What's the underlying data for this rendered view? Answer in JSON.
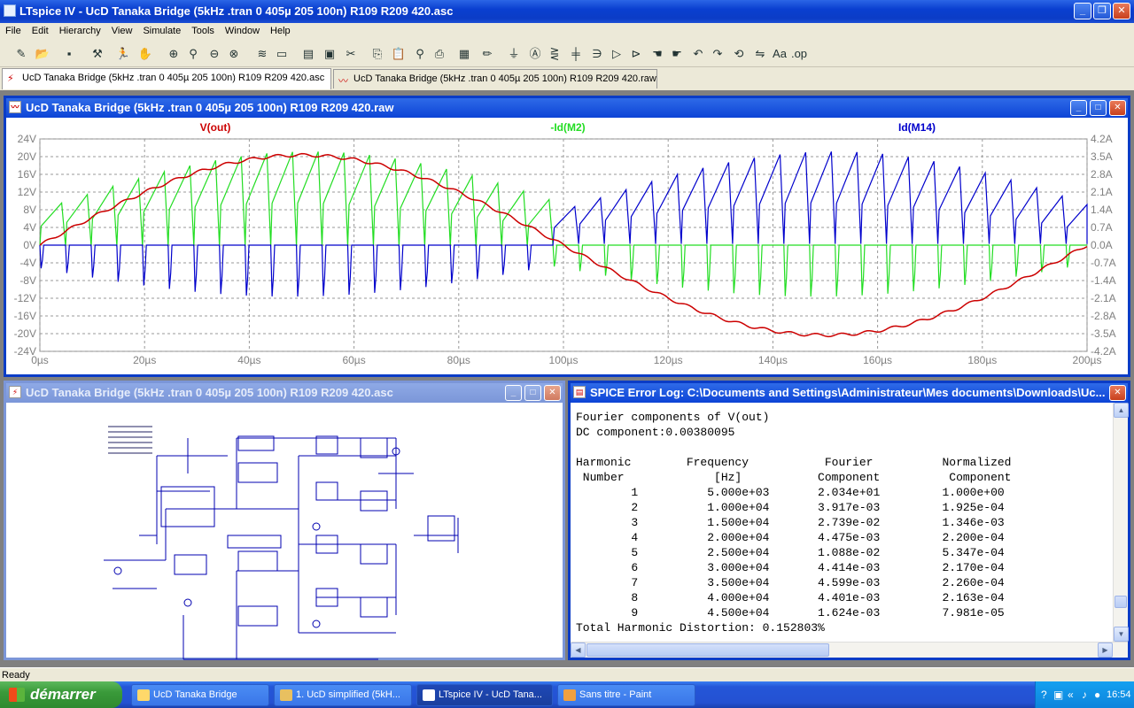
{
  "app": {
    "title": "LTspice IV - UcD Tanaka Bridge (5kHz .tran 0 405µ 205 100n) R109 R209 420.asc"
  },
  "menu": [
    "File",
    "Edit",
    "Hierarchy",
    "View",
    "Simulate",
    "Tools",
    "Window",
    "Help"
  ],
  "toolbar_icons": [
    "new-schematic-icon",
    "open-icon",
    "save-icon",
    "control-panel-icon",
    "run-icon",
    "halt-icon",
    "zoom-in-icon",
    "zoom-pan-icon",
    "zoom-out-icon",
    "zoom-fit-icon",
    "autorange-icon",
    "tile-icon",
    "cascade-icon",
    "close-window-icon",
    "cut-icon",
    "copy-icon",
    "paste-icon",
    "find-icon",
    "print-icon",
    "print-preview-icon",
    "wire-icon",
    "ground-icon",
    "label-icon",
    "resistor-icon",
    "capacitor-icon",
    "inductor-icon",
    "diode-icon",
    "component-icon",
    "move-icon",
    "drag-icon",
    "undo-icon",
    "redo-icon",
    "rotate-icon",
    "mirror-icon",
    "text-icon",
    "spice-directive-icon"
  ],
  "tabs": [
    {
      "label": "UcD Tanaka Bridge (5kHz .tran 0 405µ 205 100n) R109 R209 420.asc",
      "active": true
    },
    {
      "label": "UcD Tanaka Bridge (5kHz .tran 0 405µ 205 100n) R109 R209 420.raw",
      "active": false
    }
  ],
  "waveform_window": {
    "title": "UcD Tanaka Bridge (5kHz .tran 0 405µ 205 100n) R109 R209 420.raw",
    "traces": [
      {
        "name": "V(out)",
        "color": "#cc0000"
      },
      {
        "name": "-Id(M2)",
        "color": "#22dd22"
      },
      {
        "name": "Id(M14)",
        "color": "#0000cc"
      }
    ]
  },
  "chart_data": {
    "type": "line",
    "x_unit": "µs",
    "xlim": [
      0,
      200
    ],
    "x_ticks": [
      "0µs",
      "20µs",
      "40µs",
      "60µs",
      "80µs",
      "100µs",
      "120µs",
      "140µs",
      "160µs",
      "180µs",
      "200µs"
    ],
    "left_ylim": [
      -24,
      24
    ],
    "left_ticks": [
      "24V",
      "20V",
      "16V",
      "12V",
      "8V",
      "4V",
      "0V",
      "-4V",
      "-8V",
      "-12V",
      "-16V",
      "-20V",
      "-24V"
    ],
    "right_ylim": [
      -4.2,
      4.2
    ],
    "right_ticks": [
      "4.2A",
      "3.5A",
      "2.8A",
      "2.1A",
      "1.4A",
      "0.7A",
      "0.0A",
      "-0.7A",
      "-1.4A",
      "-2.1A",
      "-2.8A",
      "-3.5A",
      "-4.2A"
    ],
    "grid": true,
    "series": [
      {
        "name": "V(out)",
        "axis": "left",
        "kind": "sine",
        "frequency_hz": 5000,
        "amplitude": 20.34
      },
      {
        "name": "-Id(M2)",
        "axis": "right",
        "kind": "switching-sawtooth",
        "switching_period_us": 4.9
      },
      {
        "name": "Id(M14)",
        "axis": "right",
        "kind": "switching-sawtooth",
        "switching_period_us": 4.9
      }
    ]
  },
  "schematic_window": {
    "title": "UcD Tanaka Bridge (5kHz .tran 0 405µ 205 100n) R109 R209 420.asc"
  },
  "error_log": {
    "title": "SPICE Error Log: C:\\Documents and Settings\\Administrateur\\Mes documents\\Downloads\\Uc...",
    "heading": "Fourier components of V(out)",
    "dc": "DC component:0.00380095",
    "col_headers_1": [
      "Harmonic",
      "Frequency",
      "Fourier",
      "Normalized"
    ],
    "col_headers_2": [
      "Number",
      "[Hz]",
      "Component",
      "Component"
    ],
    "rows": [
      [
        "1",
        "5.000e+03",
        "2.034e+01",
        "1.000e+00"
      ],
      [
        "2",
        "1.000e+04",
        "3.917e-03",
        "1.925e-04"
      ],
      [
        "3",
        "1.500e+04",
        "2.739e-02",
        "1.346e-03"
      ],
      [
        "4",
        "2.000e+04",
        "4.475e-03",
        "2.200e-04"
      ],
      [
        "5",
        "2.500e+04",
        "1.088e-02",
        "5.347e-04"
      ],
      [
        "6",
        "3.000e+04",
        "4.414e-03",
        "2.170e-04"
      ],
      [
        "7",
        "3.500e+04",
        "4.599e-03",
        "2.260e-04"
      ],
      [
        "8",
        "4.000e+04",
        "4.401e-03",
        "2.163e-04"
      ],
      [
        "9",
        "4.500e+04",
        "1.624e-03",
        "7.981e-05"
      ]
    ],
    "thd": "Total Harmonic Distortion: 0.152803%"
  },
  "status": "Ready",
  "taskbar": {
    "start": "démarrer",
    "items": [
      {
        "label": "UcD Tanaka Bridge",
        "active": false
      },
      {
        "label": "1. UcD simplified (5kH...",
        "active": false
      },
      {
        "label": "LTspice IV - UcD Tana...",
        "active": true
      },
      {
        "label": "Sans titre - Paint",
        "active": false
      }
    ],
    "clock": "16:54"
  }
}
